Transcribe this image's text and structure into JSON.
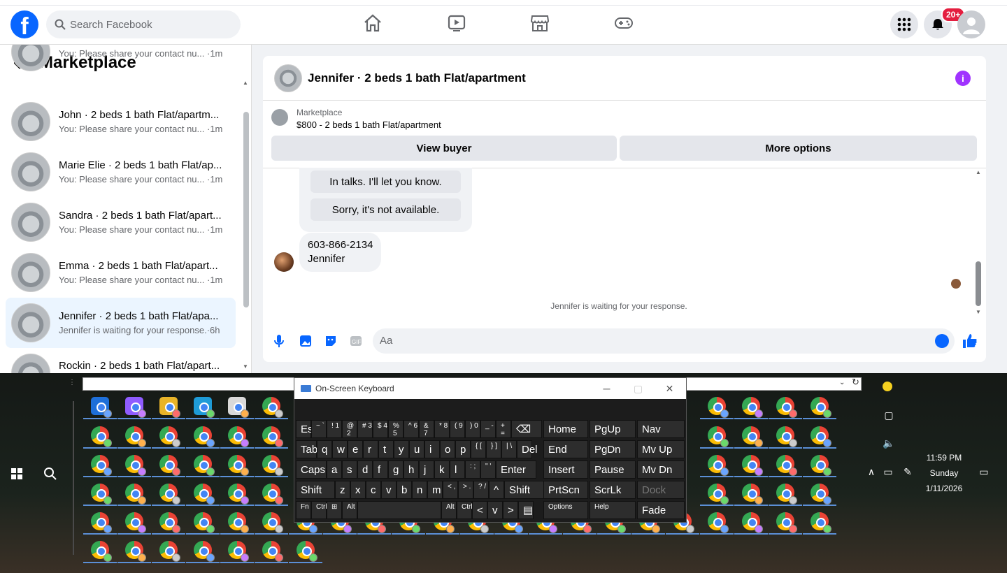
{
  "topbar": {
    "logo": "f",
    "search_placeholder": "Search Facebook",
    "notif_badge": "20+"
  },
  "left": {
    "title": "Marketplace",
    "top_partial_preview": "You: Please share your contact nu...",
    "top_partial_time": "·1m",
    "conversations": [
      {
        "name": "John · 2 beds 1 bath Flat/apartm...",
        "preview": "You: Please share your contact nu...",
        "time": "·1m"
      },
      {
        "name": "Marie Elie · 2 beds 1 bath Flat/ap...",
        "preview": "You: Please share your contact nu...",
        "time": "·1m"
      },
      {
        "name": "Sandra · 2 beds 1 bath Flat/apart...",
        "preview": "You: Please share your contact nu...",
        "time": "·1m"
      },
      {
        "name": "Emma · 2 beds 1 bath Flat/apart...",
        "preview": "You: Please share your contact nu...",
        "time": "·1m"
      },
      {
        "name": "Jennifer · 2 beds 1 bath Flat/apa...",
        "preview": "Jennifer is waiting for your response.",
        "time": "·6h"
      },
      {
        "name": "Rockin · 2 beds 1 bath Flat/apart...",
        "preview": "",
        "time": ""
      }
    ]
  },
  "chat": {
    "title": "Jennifer · 2 beds 1 bath Flat/apartment",
    "marketplace_label": "Marketplace",
    "listing": "$800 - 2 beds 1 bath Flat/apartment",
    "view_buyer": "View buyer",
    "more_options": "More options",
    "quick_replies": [
      "In talks. I'll let you know.",
      "Sorry, it's not available."
    ],
    "message_line1": "603-866-2134",
    "message_line2": "Jennifer",
    "waiting": "Jennifer is waiting for your response.",
    "composer_placeholder": "Aa"
  },
  "osk": {
    "title": "On-Screen Keyboard",
    "row1": [
      "Esc",
      "~ `",
      "! 1",
      "@ 2",
      "# 3",
      "$ 4",
      "% 5",
      "^ 6",
      "& 7",
      "* 8",
      "( 9",
      ") 0",
      "_ -",
      "+ =",
      "⌫",
      "Home",
      "PgUp",
      "Nav"
    ],
    "row2": [
      "Tab",
      "q",
      "w",
      "e",
      "r",
      "t",
      "y",
      "u",
      "i",
      "o",
      "p",
      "{ [",
      "} ]",
      "| \\",
      "Del",
      "End",
      "PgDn",
      "Mv Up"
    ],
    "row3": [
      "Caps",
      "a",
      "s",
      "d",
      "f",
      "g",
      "h",
      "j",
      "k",
      "l",
      ": ;",
      "\" '",
      "Enter",
      "Insert",
      "Pause",
      "Mv Dn"
    ],
    "row4": [
      "Shift",
      "z",
      "x",
      "c",
      "v",
      "b",
      "n",
      "m",
      "< ,",
      "> .",
      "? /",
      "^",
      "Shift",
      "PrtScn",
      "ScrLk",
      "Dock"
    ],
    "row5": [
      "Fn",
      "Ctrl",
      "⊞",
      "Alt",
      "",
      "Alt",
      "Ctrl",
      "<",
      "v",
      ">",
      "▤",
      "Options",
      "Help",
      "Fade"
    ]
  },
  "taskbar": {
    "time": "11:59 PM",
    "day": "Sunday",
    "date": "1/11/2026"
  }
}
